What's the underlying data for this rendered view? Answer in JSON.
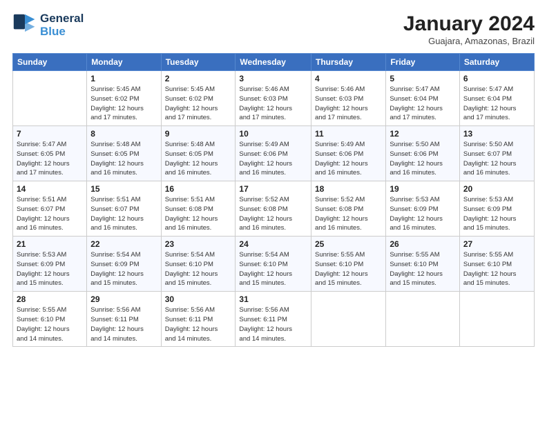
{
  "header": {
    "logo_line1": "General",
    "logo_line2": "Blue",
    "title": "January 2024",
    "subtitle": "Guajara, Amazonas, Brazil"
  },
  "calendar": {
    "days_of_week": [
      "Sunday",
      "Monday",
      "Tuesday",
      "Wednesday",
      "Thursday",
      "Friday",
      "Saturday"
    ],
    "weeks": [
      [
        {
          "day": "",
          "info": ""
        },
        {
          "day": "1",
          "info": "Sunrise: 5:45 AM\nSunset: 6:02 PM\nDaylight: 12 hours\nand 17 minutes."
        },
        {
          "day": "2",
          "info": "Sunrise: 5:45 AM\nSunset: 6:02 PM\nDaylight: 12 hours\nand 17 minutes."
        },
        {
          "day": "3",
          "info": "Sunrise: 5:46 AM\nSunset: 6:03 PM\nDaylight: 12 hours\nand 17 minutes."
        },
        {
          "day": "4",
          "info": "Sunrise: 5:46 AM\nSunset: 6:03 PM\nDaylight: 12 hours\nand 17 minutes."
        },
        {
          "day": "5",
          "info": "Sunrise: 5:47 AM\nSunset: 6:04 PM\nDaylight: 12 hours\nand 17 minutes."
        },
        {
          "day": "6",
          "info": "Sunrise: 5:47 AM\nSunset: 6:04 PM\nDaylight: 12 hours\nand 17 minutes."
        }
      ],
      [
        {
          "day": "7",
          "info": "Sunrise: 5:47 AM\nSunset: 6:05 PM\nDaylight: 12 hours\nand 17 minutes."
        },
        {
          "day": "8",
          "info": "Sunrise: 5:48 AM\nSunset: 6:05 PM\nDaylight: 12 hours\nand 16 minutes."
        },
        {
          "day": "9",
          "info": "Sunrise: 5:48 AM\nSunset: 6:05 PM\nDaylight: 12 hours\nand 16 minutes."
        },
        {
          "day": "10",
          "info": "Sunrise: 5:49 AM\nSunset: 6:06 PM\nDaylight: 12 hours\nand 16 minutes."
        },
        {
          "day": "11",
          "info": "Sunrise: 5:49 AM\nSunset: 6:06 PM\nDaylight: 12 hours\nand 16 minutes."
        },
        {
          "day": "12",
          "info": "Sunrise: 5:50 AM\nSunset: 6:06 PM\nDaylight: 12 hours\nand 16 minutes."
        },
        {
          "day": "13",
          "info": "Sunrise: 5:50 AM\nSunset: 6:07 PM\nDaylight: 12 hours\nand 16 minutes."
        }
      ],
      [
        {
          "day": "14",
          "info": "Sunrise: 5:51 AM\nSunset: 6:07 PM\nDaylight: 12 hours\nand 16 minutes."
        },
        {
          "day": "15",
          "info": "Sunrise: 5:51 AM\nSunset: 6:07 PM\nDaylight: 12 hours\nand 16 minutes."
        },
        {
          "day": "16",
          "info": "Sunrise: 5:51 AM\nSunset: 6:08 PM\nDaylight: 12 hours\nand 16 minutes."
        },
        {
          "day": "17",
          "info": "Sunrise: 5:52 AM\nSunset: 6:08 PM\nDaylight: 12 hours\nand 16 minutes."
        },
        {
          "day": "18",
          "info": "Sunrise: 5:52 AM\nSunset: 6:08 PM\nDaylight: 12 hours\nand 16 minutes."
        },
        {
          "day": "19",
          "info": "Sunrise: 5:53 AM\nSunset: 6:09 PM\nDaylight: 12 hours\nand 16 minutes."
        },
        {
          "day": "20",
          "info": "Sunrise: 5:53 AM\nSunset: 6:09 PM\nDaylight: 12 hours\nand 15 minutes."
        }
      ],
      [
        {
          "day": "21",
          "info": "Sunrise: 5:53 AM\nSunset: 6:09 PM\nDaylight: 12 hours\nand 15 minutes."
        },
        {
          "day": "22",
          "info": "Sunrise: 5:54 AM\nSunset: 6:09 PM\nDaylight: 12 hours\nand 15 minutes."
        },
        {
          "day": "23",
          "info": "Sunrise: 5:54 AM\nSunset: 6:10 PM\nDaylight: 12 hours\nand 15 minutes."
        },
        {
          "day": "24",
          "info": "Sunrise: 5:54 AM\nSunset: 6:10 PM\nDaylight: 12 hours\nand 15 minutes."
        },
        {
          "day": "25",
          "info": "Sunrise: 5:55 AM\nSunset: 6:10 PM\nDaylight: 12 hours\nand 15 minutes."
        },
        {
          "day": "26",
          "info": "Sunrise: 5:55 AM\nSunset: 6:10 PM\nDaylight: 12 hours\nand 15 minutes."
        },
        {
          "day": "27",
          "info": "Sunrise: 5:55 AM\nSunset: 6:10 PM\nDaylight: 12 hours\nand 15 minutes."
        }
      ],
      [
        {
          "day": "28",
          "info": "Sunrise: 5:55 AM\nSunset: 6:10 PM\nDaylight: 12 hours\nand 14 minutes."
        },
        {
          "day": "29",
          "info": "Sunrise: 5:56 AM\nSunset: 6:11 PM\nDaylight: 12 hours\nand 14 minutes."
        },
        {
          "day": "30",
          "info": "Sunrise: 5:56 AM\nSunset: 6:11 PM\nDaylight: 12 hours\nand 14 minutes."
        },
        {
          "day": "31",
          "info": "Sunrise: 5:56 AM\nSunset: 6:11 PM\nDaylight: 12 hours\nand 14 minutes."
        },
        {
          "day": "",
          "info": ""
        },
        {
          "day": "",
          "info": ""
        },
        {
          "day": "",
          "info": ""
        }
      ]
    ]
  }
}
